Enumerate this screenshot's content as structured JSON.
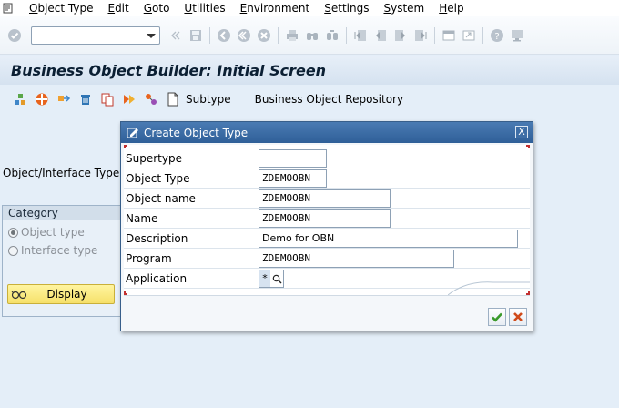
{
  "menu": {
    "items": [
      {
        "label": "Object Type"
      },
      {
        "label": "Edit"
      },
      {
        "label": "Goto"
      },
      {
        "label": "Utilities"
      },
      {
        "label": "Environment"
      },
      {
        "label": "Settings"
      },
      {
        "label": "System"
      },
      {
        "label": "Help"
      }
    ]
  },
  "system_toolbar": {
    "command_value": ""
  },
  "title": "Business Object Builder: Initial Screen",
  "app_toolbar": {
    "subtype_label": "Subtype",
    "repository_label": "Business Object Repository"
  },
  "background": {
    "field_label": "Object/Interface Type",
    "category": {
      "heading": "Category",
      "options": [
        {
          "label": "Object type",
          "selected": true
        },
        {
          "label": "Interface type",
          "selected": false
        }
      ]
    },
    "display_button": "Display"
  },
  "dialog": {
    "title": "Create Object Type",
    "close_glyph": "X",
    "fields": [
      {
        "label": "Supertype",
        "value": ""
      },
      {
        "label": "Object Type",
        "value": "ZDEMOOBN"
      },
      {
        "label": "Object name",
        "value": "ZDEMOOBN"
      },
      {
        "label": "Name",
        "value": "ZDEMOOBN"
      },
      {
        "label": "Description",
        "value": "Demo for OBN"
      },
      {
        "label": "Program",
        "value": "ZDEMOOBN"
      },
      {
        "label": "Application",
        "value": "*"
      }
    ]
  },
  "colors": {
    "dialog_header": "#2f5f98",
    "display_button": "#f6e06a",
    "confirm": "#3a9a2a",
    "cancel": "#d04a1a"
  }
}
